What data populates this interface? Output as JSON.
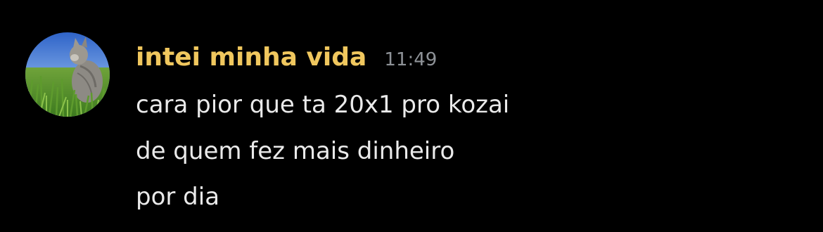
{
  "message": {
    "author": "intei minha vida",
    "timestamp": "11:49",
    "lines": [
      "cara pior que ta 20x1 pro kozai",
      "de quem fez mais dinheiro",
      "por dia"
    ]
  },
  "colors": {
    "background": "#000000",
    "author": "#f0c75e",
    "timestamp": "#8e9297",
    "text": "#eaeaea"
  },
  "icons": {
    "avatar": "cat-in-grass-avatar"
  }
}
